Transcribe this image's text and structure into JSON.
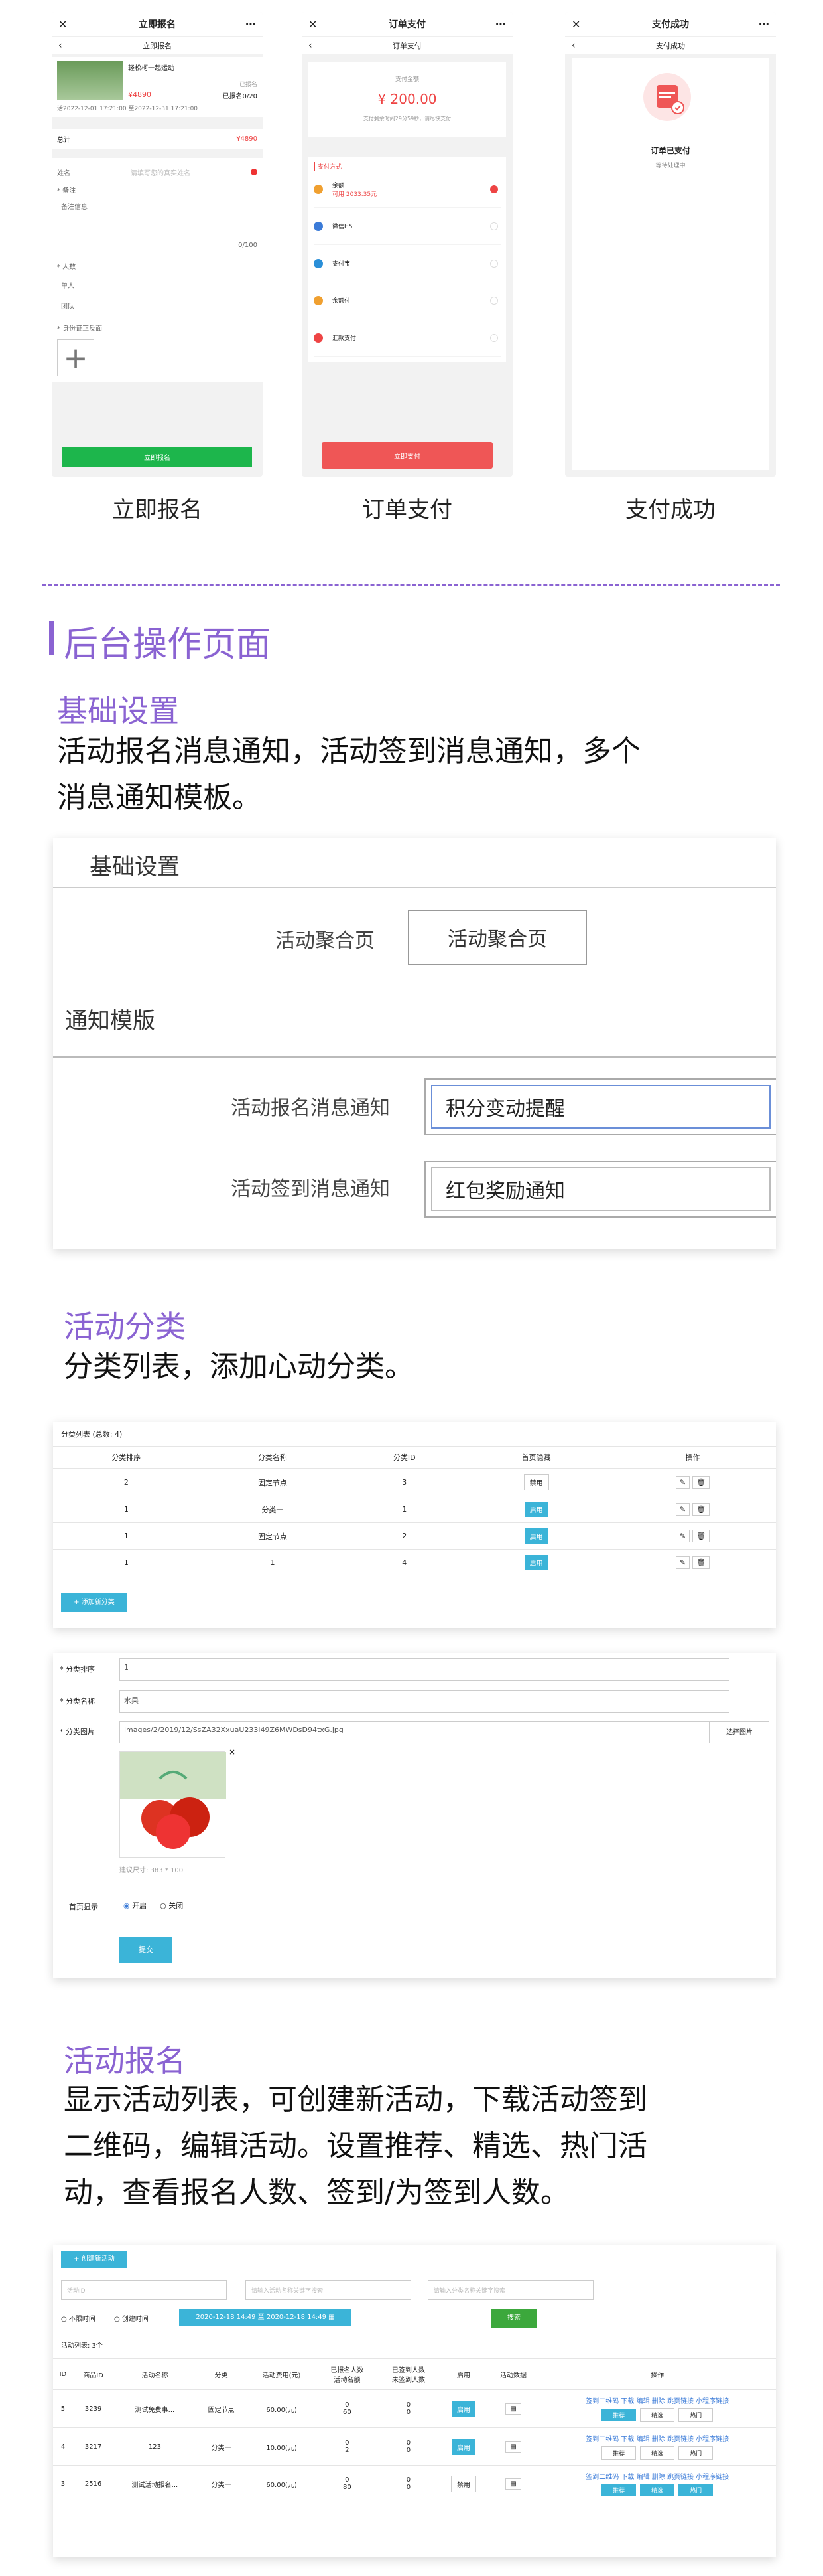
{
  "phones": {
    "signup": {
      "title": "立即报名",
      "sub": "立即报名",
      "activity_name": "轻松柯一起运动",
      "status_badge": "已报名",
      "price": "¥4890",
      "count": "已报名0/20",
      "time_range": "活2022-12-01 17:21:00 至2022-12-31 17:21:00",
      "total_label": "总计",
      "total_value": "¥4890",
      "name_label": "姓名",
      "name_placeholder": "请填写您的真实姓名",
      "note_label": "* 备注",
      "note_value": "备注信息",
      "counter": "0/100",
      "people_label": "* 人数",
      "people_opt1": "单人",
      "people_opt2": "团队",
      "photo_label": "* 身份证正反面",
      "submit": "立即报名"
    },
    "pay": {
      "title": "订单支付",
      "sub": "订单支付",
      "amount_label": "支付金额",
      "amount": "¥ 200.00",
      "amount_note": "支付剩余时间29分59秒，请尽快支付",
      "methods_title": "支付方式",
      "methods": [
        {
          "name": "余额",
          "sub": "可用 2033.35元",
          "checked": true
        },
        {
          "name": "微信H5",
          "sub": "",
          "checked": false
        },
        {
          "name": "支付宝",
          "sub": "",
          "checked": false
        },
        {
          "name": "余额付",
          "sub": "",
          "checked": false
        },
        {
          "name": "汇款支付",
          "sub": "",
          "checked": false
        }
      ],
      "pay_button": "立即支付"
    },
    "success": {
      "title": "支付成功",
      "sub": "支付成功",
      "status": "订单已支付",
      "note": "等待处理中"
    }
  },
  "captions": [
    "立即报名",
    "订单支付",
    "支付成功"
  ],
  "section_title": "后台操作页面",
  "basic": {
    "heading": "基础设置",
    "desc": [
      "活动报名消息通知，活动签到消息通知，多个",
      "消息通知模板。"
    ],
    "panel_title": "基础设置",
    "agg_label": "活动聚合页",
    "agg_button": "活动聚合页",
    "notice_title": "通知模版",
    "signup_label": "活动报名消息通知",
    "signup_value": "积分变动提醒",
    "checkin_label": "活动签到消息通知",
    "checkin_value": "红包奖励通知"
  },
  "category": {
    "heading": "活动分类",
    "desc": "分类列表，添加心动分类。",
    "list_title": "分类列表 (总数: 4)",
    "columns": [
      "分类排序",
      "分类名称",
      "分类ID",
      "首页隐藏",
      "操作"
    ],
    "rows": [
      {
        "sort": "2",
        "name": "固定节点",
        "id": "3",
        "state": "禁用"
      },
      {
        "sort": "1",
        "name": "分类一",
        "id": "1",
        "state": "启用"
      },
      {
        "sort": "1",
        "name": "固定节点",
        "id": "2",
        "state": "启用"
      },
      {
        "sort": "1",
        "name": "1",
        "id": "4",
        "state": "启用"
      }
    ],
    "add_button": "添加新分类",
    "form": {
      "sort_label": "* 分类排序",
      "sort_value": "1",
      "name_label": "* 分类名称",
      "name_value": "水果",
      "img_label": "* 分类图片",
      "img_value": "images/2/2019/12/SsZA32XxuaU233i49Z6MWDsD94txG.jpg",
      "choose": "选择图片",
      "size_note": "建议尺寸: 383 * 100",
      "show_label": "首页显示",
      "opt_on": "开启",
      "opt_off": "关闭",
      "submit": "提交"
    }
  },
  "activity": {
    "heading": "活动报名",
    "desc": [
      "显示活动列表，可创建新活动，下载活动签到",
      "二维码，编辑活动。设置推荐、精选、热门活",
      "动，查看报名人数、签到/为签到人数。"
    ],
    "create_button": "创建新活动",
    "filter1_placeholder": "活动ID",
    "filter2_placeholder": "请输入活动名称关键字搜索",
    "filter3_placeholder": "请输入分类名称关键字搜索",
    "radio1": "不限时间",
    "radio2": "创建时间",
    "date_range": "2020-12-18 14:49 至 2020-12-18 14:49",
    "search": "搜索",
    "list_title": "活动列表: 3个",
    "columns": [
      "ID",
      "商品ID",
      "活动名称",
      "分类",
      "活动费用(元)",
      "已报名人数\n活动名额",
      "已签到人数\n未签到人数",
      "启用",
      "活动数据",
      "操作"
    ],
    "rows": [
      {
        "id": "5",
        "gid": "3239",
        "name": "测试免费事...",
        "cat": "固定节点",
        "fee": "60.00(元)",
        "signed": "0",
        "quota": "60",
        "checked": "0",
        "unchecked": "0",
        "state": "启用"
      },
      {
        "id": "4",
        "gid": "3217",
        "name": "123",
        "cat": "分类一",
        "fee": "10.00(元)",
        "signed": "0",
        "quota": "2",
        "checked": "0",
        "unchecked": "0",
        "state": "启用"
      },
      {
        "id": "3",
        "gid": "2516",
        "name": "测试活动报名...",
        "cat": "分类一",
        "fee": "60.00(元)",
        "signed": "0",
        "quota": "80",
        "checked": "0",
        "unchecked": "0",
        "state": "禁用"
      }
    ],
    "ops": "签到二维码 下载 编辑 删除 跳页链接 小程序链接",
    "tags": [
      "推荐",
      "精选",
      "热门"
    ]
  }
}
